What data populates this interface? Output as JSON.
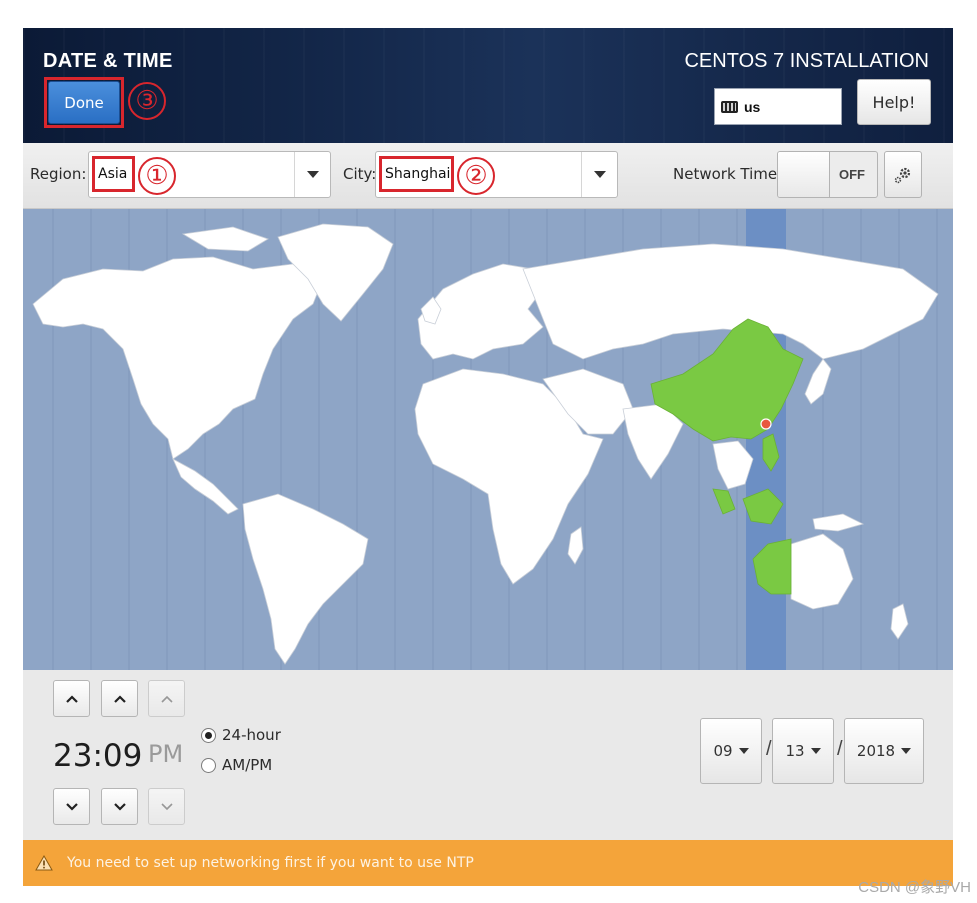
{
  "header": {
    "title": "DATE & TIME",
    "product": "CENTOS 7 INSTALLATION",
    "done_label": "Done",
    "keyboard_layout": "us",
    "help_label": "Help!"
  },
  "annotations": [
    "①",
    "②",
    "③"
  ],
  "toolbar": {
    "region_label": "Region:",
    "region_value": "Asia",
    "city_label": "City:",
    "city_value": "Shanghai",
    "network_time_label": "Network Time",
    "network_time_state": "OFF"
  },
  "map": {
    "highlight_color": "#7ac943",
    "ocean_color": "#8ea5c6",
    "selected_zone_color": "#6c8fc4",
    "marker_color": "#e8573f"
  },
  "time": {
    "hours": "23",
    "minutes": "09",
    "ampm": "PM",
    "format_24h_label": "24-hour",
    "format_ampm_label": "AM/PM",
    "format_selected": "24-hour"
  },
  "date": {
    "month": "09",
    "day": "13",
    "year": "2018",
    "separator": "/"
  },
  "warning": {
    "text": "You need to set up networking first if you want to use NTP"
  },
  "watermark": "CSDN @象野VH"
}
